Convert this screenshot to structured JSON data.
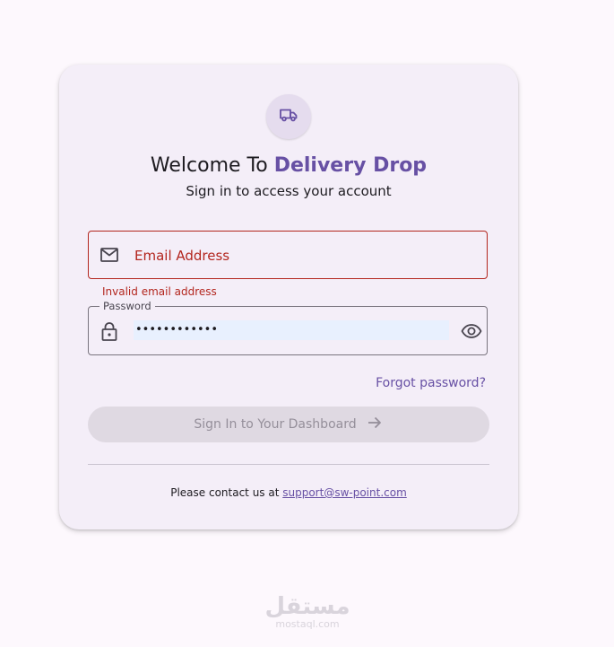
{
  "header": {
    "title_prefix": "Welcome To ",
    "brand": "Delivery Drop",
    "subtitle": "Sign in to access your account"
  },
  "form": {
    "email": {
      "placeholder": "Email Address",
      "value": "",
      "error": "Invalid email address"
    },
    "password": {
      "label": "Password",
      "value": "••••••••••••"
    },
    "forgot_label": "Forgot password?",
    "submit_label": "Sign In to Your Dashboard"
  },
  "footer": {
    "contact_prefix": "Please contact us at ",
    "contact_email": "support@sw-point.com"
  },
  "watermark": {
    "arabic": "مستقل",
    "latin": "mostaql.com"
  },
  "icons": {
    "logo": "truck-icon",
    "email": "mail-icon",
    "password": "lock-icon",
    "visibility": "eye-icon",
    "submit": "arrow-right-icon"
  },
  "colors": {
    "brand": "#6750a4",
    "error": "#b3261e",
    "card": "#f4eef8",
    "background": "#fdf8fd",
    "disabled_button": "#dfd9e2"
  }
}
